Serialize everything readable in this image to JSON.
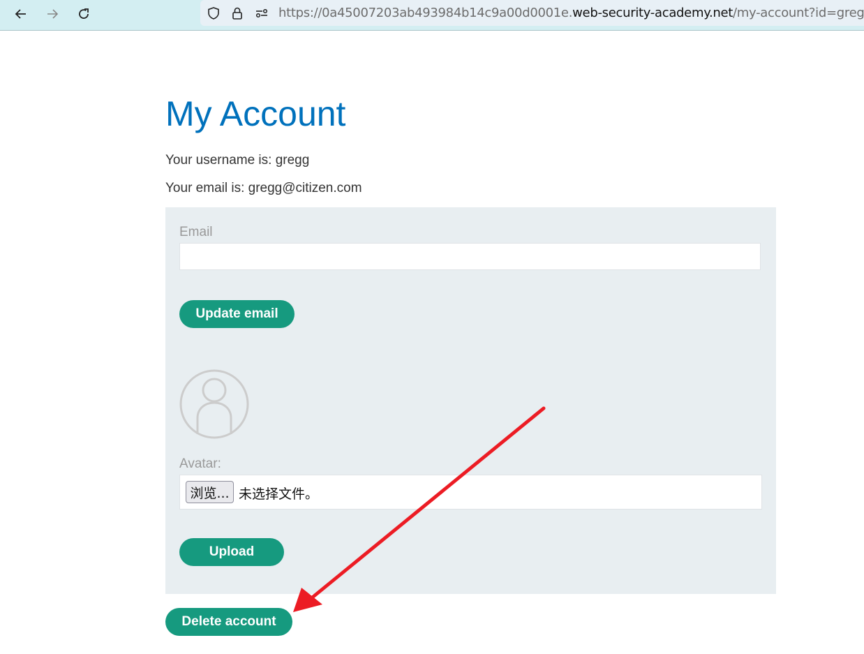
{
  "browser": {
    "nav": {
      "back_icon": "arrow-left-icon",
      "forward_icon": "arrow-right-icon",
      "reload_icon": "reload-icon"
    },
    "url": {
      "prefix": "https://0a45007203ab493984b14c9a00d0001e.",
      "host": "web-security-academy.net",
      "path": "/my-account?id=gregg"
    },
    "url_icons": [
      "shield-icon",
      "lock-icon",
      "permissions-icon"
    ]
  },
  "page": {
    "title": "My Account",
    "username_line": "Your username is: gregg",
    "email_line": "Your email is: gregg@citizen.com",
    "email_form": {
      "label": "Email",
      "value": "",
      "submit_label": "Update email"
    },
    "avatar_form": {
      "avatar_icon": "user-avatar-icon",
      "label": "Avatar:",
      "browse_label": "浏览...",
      "no_file_text": "未选择文件。",
      "submit_label": "Upload"
    },
    "delete_label": "Delete account"
  },
  "annotation": {
    "type": "red-arrow",
    "points_to": "Delete account",
    "color": "#ec1c24"
  },
  "colors": {
    "accent_blue": "#0071bc",
    "button_green": "#169a7f",
    "panel_bg": "#e8eef1"
  }
}
